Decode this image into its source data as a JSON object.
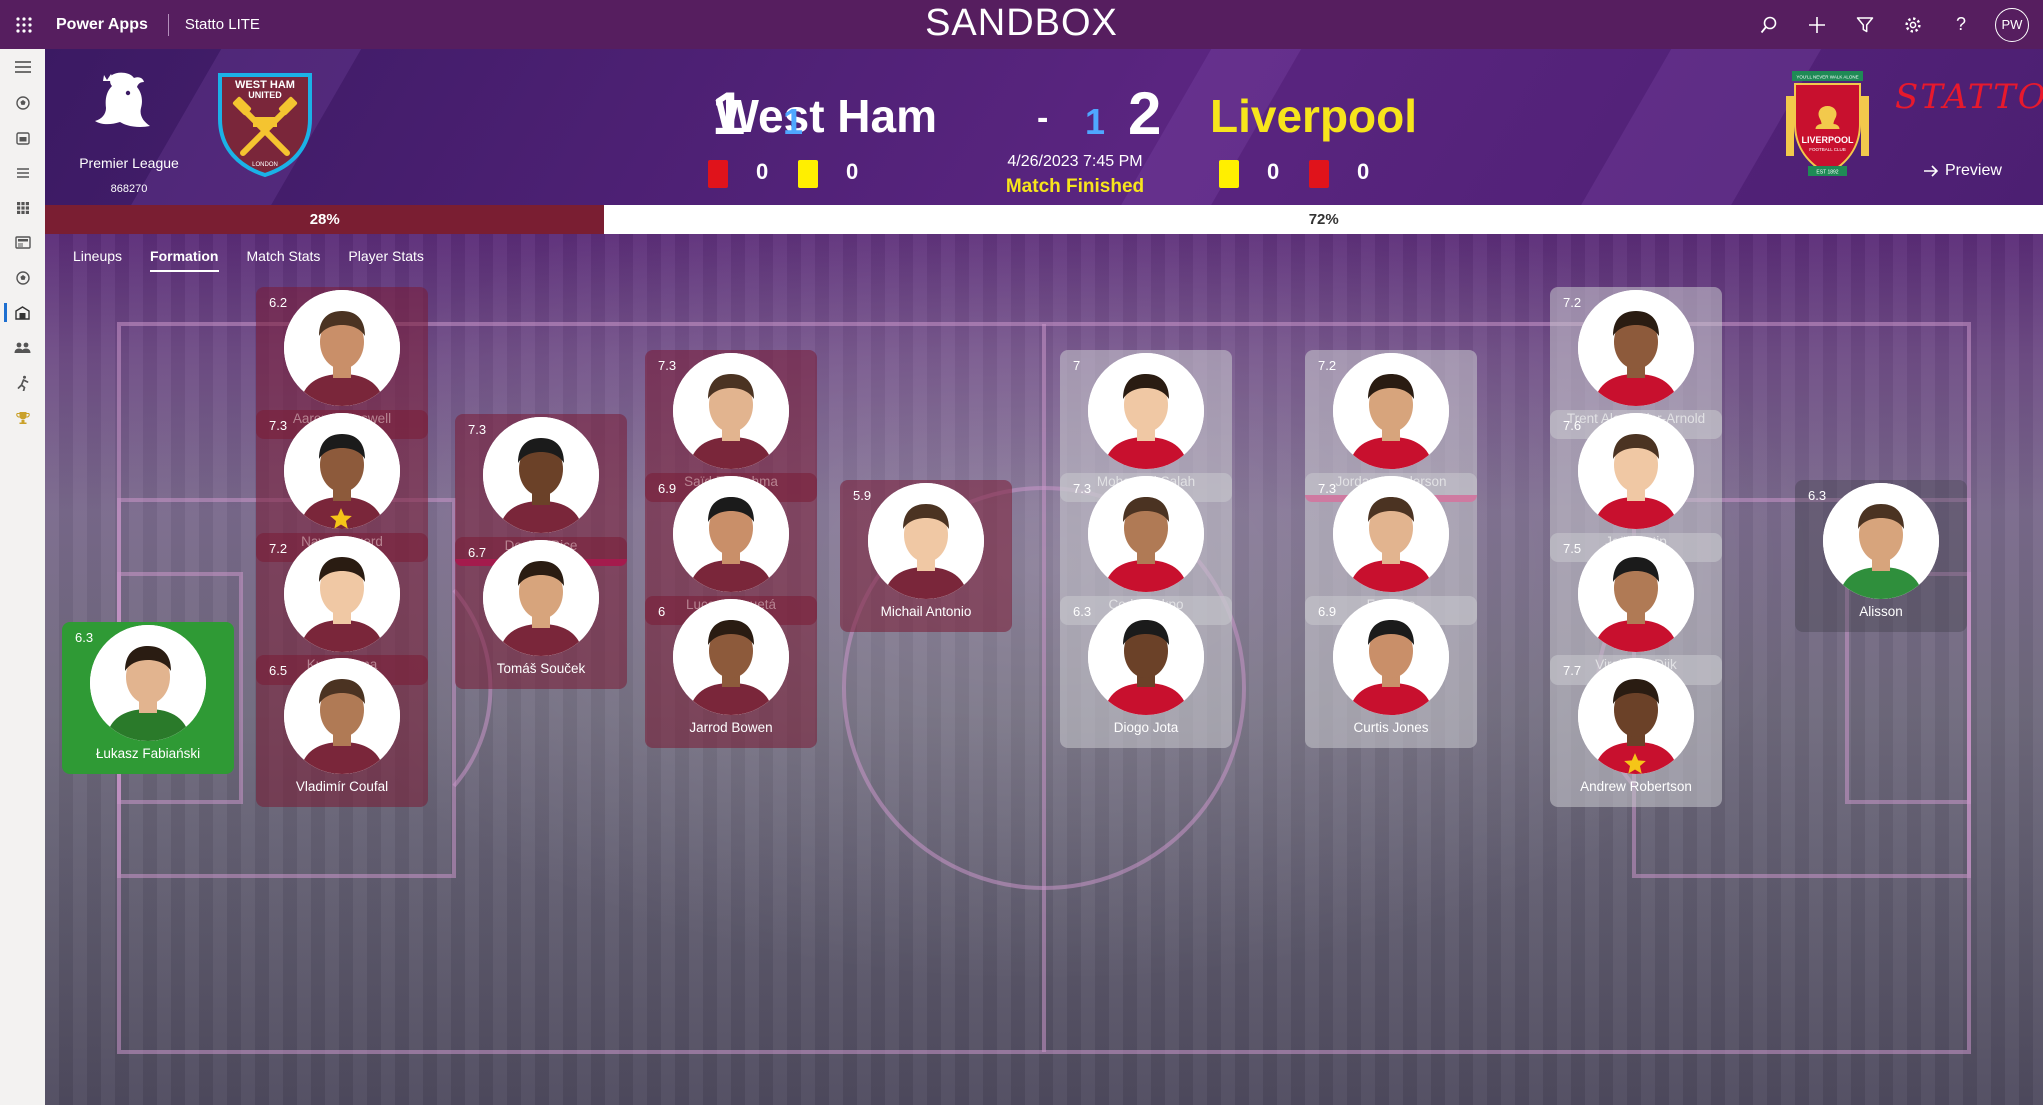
{
  "app": {
    "name": "Power Apps",
    "sub": "Statto LITE",
    "environment": "SANDBOX",
    "user_initials": "PW",
    "top_icons": [
      "search-icon",
      "plus-icon",
      "filter-icon",
      "settings-icon",
      "help-icon"
    ]
  },
  "left_rail": [
    "hamburger-icon",
    "ball-icon",
    "calendar-icon",
    "list-icon",
    "grid-icon",
    "news-icon",
    "ball-icon",
    "stadium-icon",
    "people-icon",
    "runner-icon",
    "trophy-icon"
  ],
  "match": {
    "league_name": "Premier League",
    "match_id": "868270",
    "home": {
      "name": "West Ham",
      "score": "1",
      "half_score": "1",
      "red_cards": "0",
      "yellow_cards": "0"
    },
    "away": {
      "name": "Liverpool",
      "score": "2",
      "half_score": "1",
      "red_cards": "0",
      "yellow_cards": "0"
    },
    "separator": "-",
    "datetime": "4/26/2023 7:45 PM",
    "status": "Match Finished",
    "brand": "STATTO",
    "preview_label": "Preview",
    "crest_home_text": [
      "WEST HAM",
      "UNITED",
      "LONDON"
    ],
    "crest_away_text": [
      "YOU'LL NEVER WALK ALONE",
      "LIVERPOOL",
      "FOOTBALL CLUB",
      "EST 1892"
    ]
  },
  "possession": {
    "home_pct": 28,
    "away_pct": 72,
    "home_label": "28%",
    "away_label": "72%"
  },
  "tabs": [
    {
      "label": "Lineups",
      "active": false
    },
    {
      "label": "Formation",
      "active": true
    },
    {
      "label": "Match Stats",
      "active": false
    },
    {
      "label": "Player Stats",
      "active": false
    }
  ],
  "colors": {
    "topbar": "#561e5f",
    "home_card": "#7a1c34",
    "home_gk": "#2f9a35",
    "away_card": "#c8c8cd",
    "away_name": "#f7e51c",
    "accent_blue": "#4fa7ff"
  },
  "home_players": [
    {
      "name": "Łukasz Fabiański",
      "rating": "6.3",
      "gk": true
    },
    {
      "name": "Aaron Cresswell",
      "rating": "6.2"
    },
    {
      "name": "Nayef Aguerd",
      "rating": "7.3",
      "star": true
    },
    {
      "name": "Kurt Zouma",
      "rating": "7.2"
    },
    {
      "name": "Vladimír Coufal",
      "rating": "6.5"
    },
    {
      "name": "Declan Rice",
      "rating": "7.3",
      "captain": true
    },
    {
      "name": "Tomáš Souček",
      "rating": "6.7"
    },
    {
      "name": "Saïd Benrahma",
      "rating": "7.3"
    },
    {
      "name": "Lucas Paquetá",
      "rating": "6.9"
    },
    {
      "name": "Jarrod Bowen",
      "rating": "6"
    },
    {
      "name": "Michail Antonio",
      "rating": "5.9"
    }
  ],
  "away_players": [
    {
      "name": "Mohamed Salah",
      "rating": "7"
    },
    {
      "name": "Cody Gakpo",
      "rating": "7.3"
    },
    {
      "name": "Diogo Jota",
      "rating": "6.3"
    },
    {
      "name": "Jordan Henderson",
      "rating": "7.2",
      "captain": true
    },
    {
      "name": "Fabinho",
      "rating": "7.3"
    },
    {
      "name": "Curtis Jones",
      "rating": "6.9"
    },
    {
      "name": "Trent Alexander-Arnold",
      "rating": "7.2"
    },
    {
      "name": "Joël Matip",
      "rating": "7.6"
    },
    {
      "name": "Virgil van Dijk",
      "rating": "7.5"
    },
    {
      "name": "Andrew Robertson",
      "rating": "7.7",
      "star": true
    },
    {
      "name": "Alisson",
      "rating": "6.3",
      "gk": true
    }
  ]
}
